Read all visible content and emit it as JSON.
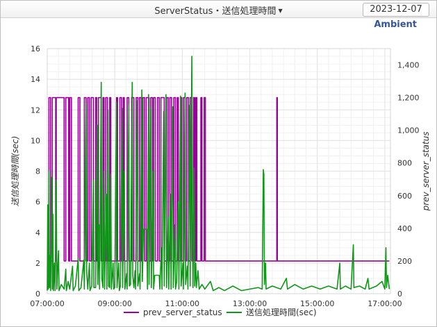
{
  "header": {
    "title": "ServerStatus・送信処理時間",
    "date": "2023-12-07"
  },
  "brand": "Ambient",
  "icons": {
    "title_dropdown": "caret-down-icon"
  },
  "chart_data": {
    "type": "line",
    "title": "",
    "x_ticks": [
      "07:00:00",
      "09:00:00",
      "11:00:00",
      "13:00:00",
      "15:00:00",
      "17:00:00"
    ],
    "x_range": [
      "07:00",
      "17:10"
    ],
    "ylabel_left": "送信処理時間(sec)",
    "ylabel_right": "prev_server_status",
    "ylim_left": [
      0,
      16
    ],
    "ylim_right": [
      0,
      1500
    ],
    "y_ticks_left": [
      "0",
      "2",
      "4",
      "6",
      "8",
      "10",
      "12",
      "14",
      "16"
    ],
    "y_ticks_right": [
      "0",
      "200",
      "400",
      "600",
      "800",
      "1,000",
      "1,200",
      "1,400"
    ],
    "grid": true,
    "legend_position": "bottom",
    "colors": {
      "prev_server_status": "#990099",
      "send_time": "#109618",
      "grid": "#e3e3e3"
    },
    "series": [
      {
        "name": "prev_server_status",
        "axis": "right",
        "color": "#990099",
        "step": true,
        "points": [
          [
            "07:00",
            200
          ],
          [
            "07:03",
            1200
          ],
          [
            "07:06",
            200
          ],
          [
            "07:09",
            1200
          ],
          [
            "07:15",
            200
          ],
          [
            "07:16",
            1200
          ],
          [
            "07:30",
            200
          ],
          [
            "07:33",
            1200
          ],
          [
            "07:38",
            200
          ],
          [
            "07:40",
            1200
          ],
          [
            "07:43",
            200
          ],
          [
            "07:55",
            1200
          ],
          [
            "07:58",
            200
          ],
          [
            "08:06",
            1200
          ],
          [
            "08:09",
            200
          ],
          [
            "08:12",
            1200
          ],
          [
            "08:15",
            200
          ],
          [
            "08:18",
            1200
          ],
          [
            "08:22",
            200
          ],
          [
            "08:26",
            1200
          ],
          [
            "08:28",
            200
          ],
          [
            "08:31",
            1200
          ],
          [
            "08:36",
            200
          ],
          [
            "08:39",
            1200
          ],
          [
            "08:41",
            200
          ],
          [
            "08:44",
            1200
          ],
          [
            "08:47",
            200
          ],
          [
            "08:51",
            1200
          ],
          [
            "08:53",
            200
          ],
          [
            "09:03",
            1200
          ],
          [
            "09:05",
            200
          ],
          [
            "09:09",
            1200
          ],
          [
            "09:12",
            200
          ],
          [
            "09:15",
            1200
          ],
          [
            "09:17",
            200
          ],
          [
            "09:22",
            1200
          ],
          [
            "09:25",
            200
          ],
          [
            "09:30",
            1200
          ],
          [
            "09:34",
            200
          ],
          [
            "09:38",
            1200
          ],
          [
            "09:41",
            200
          ],
          [
            "09:44",
            1200
          ],
          [
            "09:47",
            200
          ],
          [
            "09:50",
            1200
          ],
          [
            "09:53",
            200
          ],
          [
            "09:56",
            1200
          ],
          [
            "10:01",
            200
          ],
          [
            "10:04",
            1200
          ],
          [
            "10:07",
            200
          ],
          [
            "10:09",
            1200
          ],
          [
            "10:12",
            200
          ],
          [
            "10:16",
            1200
          ],
          [
            "10:19",
            200
          ],
          [
            "10:22",
            1200
          ],
          [
            "10:28",
            200
          ],
          [
            "10:32",
            1200
          ],
          [
            "10:35",
            200
          ],
          [
            "10:38",
            1200
          ],
          [
            "10:41",
            200
          ],
          [
            "10:45",
            1200
          ],
          [
            "10:48",
            200
          ],
          [
            "10:51",
            1200
          ],
          [
            "10:53",
            200
          ],
          [
            "10:57",
            1200
          ],
          [
            "10:59",
            200
          ],
          [
            "11:02",
            1200
          ],
          [
            "11:05",
            200
          ],
          [
            "11:08",
            1200
          ],
          [
            "11:11",
            200
          ],
          [
            "11:14",
            1200
          ],
          [
            "11:17",
            200
          ],
          [
            "11:20",
            1200
          ],
          [
            "11:22",
            200
          ],
          [
            "11:24",
            1200
          ],
          [
            "11:26",
            200
          ],
          [
            "11:33",
            1200
          ],
          [
            "11:35",
            200
          ],
          [
            "11:39",
            1200
          ],
          [
            "11:41",
            200
          ],
          [
            "13:47",
            200
          ],
          [
            "13:48",
            1200
          ],
          [
            "13:49",
            200
          ],
          [
            "17:08",
            200
          ]
        ]
      },
      {
        "name": "送信処理時間(sec)",
        "axis": "left",
        "color": "#109618",
        "step": false,
        "points": [
          [
            "07:00",
            0.2
          ],
          [
            "07:01",
            5.8
          ],
          [
            "07:02",
            0.3
          ],
          [
            "07:03",
            8.0
          ],
          [
            "07:04",
            0.4
          ],
          [
            "07:05",
            2.5
          ],
          [
            "07:06",
            0.2
          ],
          [
            "07:08",
            7.6
          ],
          [
            "07:09",
            0.3
          ],
          [
            "07:10",
            5.2
          ],
          [
            "07:11",
            0.2
          ],
          [
            "07:13",
            2.0
          ],
          [
            "07:14",
            0.2
          ],
          [
            "07:16",
            7.4
          ],
          [
            "07:17",
            0.3
          ],
          [
            "07:20",
            2.8
          ],
          [
            "07:21",
            0.2
          ],
          [
            "07:25",
            0.6
          ],
          [
            "07:30",
            0.3
          ],
          [
            "07:33",
            1.6
          ],
          [
            "07:34",
            0.2
          ],
          [
            "07:37",
            0.8
          ],
          [
            "07:40",
            0.3
          ],
          [
            "07:45",
            1.8
          ],
          [
            "07:46",
            0.2
          ],
          [
            "07:50",
            0.5
          ],
          [
            "07:55",
            2.3
          ],
          [
            "07:56",
            0.2
          ],
          [
            "08:00",
            0.4
          ],
          [
            "08:05",
            2.2
          ],
          [
            "08:06",
            0.3
          ],
          [
            "08:09",
            12.4
          ],
          [
            "08:10",
            1.5
          ],
          [
            "08:12",
            0.3
          ],
          [
            "08:15",
            2.0
          ],
          [
            "08:16",
            0.2
          ],
          [
            "08:19",
            0.5
          ],
          [
            "08:22",
            7.4
          ],
          [
            "08:23",
            0.4
          ],
          [
            "08:26",
            0.4
          ],
          [
            "08:29",
            11.0
          ],
          [
            "08:30",
            0.6
          ],
          [
            "08:32",
            4.5
          ],
          [
            "08:33",
            0.3
          ],
          [
            "08:36",
            13.8
          ],
          [
            "08:37",
            1.0
          ],
          [
            "08:39",
            0.4
          ],
          [
            "08:41",
            8.0
          ],
          [
            "08:42",
            0.3
          ],
          [
            "08:45",
            6.5
          ],
          [
            "08:46",
            0.3
          ],
          [
            "08:48",
            12.0
          ],
          [
            "08:49",
            0.5
          ],
          [
            "08:51",
            0.4
          ],
          [
            "08:53",
            7.8
          ],
          [
            "08:54",
            0.3
          ],
          [
            "08:57",
            2.0
          ],
          [
            "08:58",
            0.3
          ],
          [
            "09:00",
            0.4
          ],
          [
            "09:03",
            12.5
          ],
          [
            "09:04",
            0.4
          ],
          [
            "09:07",
            2.0
          ],
          [
            "09:08",
            0.2
          ],
          [
            "09:10",
            0.5
          ],
          [
            "09:13",
            12.1
          ],
          [
            "09:14",
            0.4
          ],
          [
            "09:17",
            8.0
          ],
          [
            "09:18",
            0.3
          ],
          [
            "09:21",
            1.3
          ],
          [
            "09:22",
            0.3
          ],
          [
            "09:25",
            12.3
          ],
          [
            "09:26",
            0.5
          ],
          [
            "09:28",
            0.6
          ],
          [
            "09:31",
            13.8
          ],
          [
            "09:32",
            1.2
          ],
          [
            "09:34",
            0.4
          ],
          [
            "09:36",
            1.5
          ],
          [
            "09:37",
            0.3
          ],
          [
            "09:40",
            12.6
          ],
          [
            "09:41",
            0.5
          ],
          [
            "09:44",
            1.3
          ],
          [
            "09:45",
            0.3
          ],
          [
            "09:48",
            13.3
          ],
          [
            "09:49",
            0.8
          ],
          [
            "09:51",
            4.2
          ],
          [
            "09:57",
            4.2
          ],
          [
            "09:58",
            0.3
          ],
          [
            "10:00",
            13.0
          ],
          [
            "10:01",
            0.6
          ],
          [
            "10:04",
            12.1
          ],
          [
            "10:05",
            0.4
          ],
          [
            "10:08",
            8.0
          ],
          [
            "10:09",
            0.3
          ],
          [
            "10:11",
            1.2
          ],
          [
            "10:19",
            1.2
          ],
          [
            "10:20",
            0.3
          ],
          [
            "10:23",
            3.0
          ],
          [
            "10:24",
            0.3
          ],
          [
            "10:27",
            11.9
          ],
          [
            "10:28",
            0.5
          ],
          [
            "10:31",
            13.0
          ],
          [
            "10:32",
            0.4
          ],
          [
            "10:35",
            5.0
          ],
          [
            "10:36",
            0.3
          ],
          [
            "10:39",
            6.5
          ],
          [
            "10:40",
            0.3
          ],
          [
            "10:43",
            12.2
          ],
          [
            "10:44",
            0.4
          ],
          [
            "10:47",
            4.5
          ],
          [
            "10:48",
            0.3
          ],
          [
            "10:50",
            0.8
          ],
          [
            "10:53",
            6.0
          ],
          [
            "10:54",
            0.3
          ],
          [
            "10:57",
            12.9
          ],
          [
            "10:58",
            0.5
          ],
          [
            "11:01",
            2.0
          ],
          [
            "11:02",
            0.3
          ],
          [
            "11:05",
            13.1
          ],
          [
            "11:06",
            0.6
          ],
          [
            "11:09",
            1.8
          ],
          [
            "11:10",
            0.3
          ],
          [
            "11:13",
            12.3
          ],
          [
            "11:14",
            0.5
          ],
          [
            "11:17",
            15.5
          ],
          [
            "11:18",
            5.0
          ],
          [
            "11:19",
            0.4
          ],
          [
            "11:21",
            8.2
          ],
          [
            "11:22",
            0.5
          ],
          [
            "11:24",
            2.0
          ],
          [
            "11:25",
            0.4
          ],
          [
            "11:28",
            1.5
          ],
          [
            "11:30",
            0.3
          ],
          [
            "11:35",
            0.6
          ],
          [
            "11:40",
            0.3
          ],
          [
            "11:50",
            0.8
          ],
          [
            "11:55",
            0.2
          ],
          [
            "12:05",
            0.4
          ],
          [
            "12:15",
            0.2
          ],
          [
            "12:30",
            0.5
          ],
          [
            "12:45",
            0.2
          ],
          [
            "13:00",
            0.3
          ],
          [
            "13:15",
            0.4
          ],
          [
            "13:22",
            0.3
          ],
          [
            "13:24",
            8.1
          ],
          [
            "13:25",
            7.8
          ],
          [
            "13:26",
            0.6
          ],
          [
            "13:28",
            2.0
          ],
          [
            "13:29",
            0.3
          ],
          [
            "13:40",
            0.5
          ],
          [
            "13:55",
            0.3
          ],
          [
            "14:05",
            1.0
          ],
          [
            "14:07",
            0.3
          ],
          [
            "14:20",
            0.6
          ],
          [
            "14:35",
            0.3
          ],
          [
            "14:50",
            0.5
          ],
          [
            "15:05",
            0.3
          ],
          [
            "15:20",
            0.5
          ],
          [
            "15:35",
            0.3
          ],
          [
            "15:40",
            2.0
          ],
          [
            "15:41",
            0.3
          ],
          [
            "15:50",
            0.5
          ],
          [
            "16:00",
            0.3
          ],
          [
            "16:04",
            3.2
          ],
          [
            "16:05",
            0.4
          ],
          [
            "16:15",
            0.5
          ],
          [
            "16:25",
            0.3
          ],
          [
            "16:30",
            1.0
          ],
          [
            "16:32",
            0.3
          ],
          [
            "16:45",
            0.5
          ],
          [
            "16:55",
            0.8
          ],
          [
            "17:00",
            0.3
          ],
          [
            "17:02",
            3.0
          ],
          [
            "17:03",
            0.4
          ],
          [
            "17:05",
            1.2
          ],
          [
            "17:08",
            0.3
          ]
        ]
      }
    ]
  }
}
